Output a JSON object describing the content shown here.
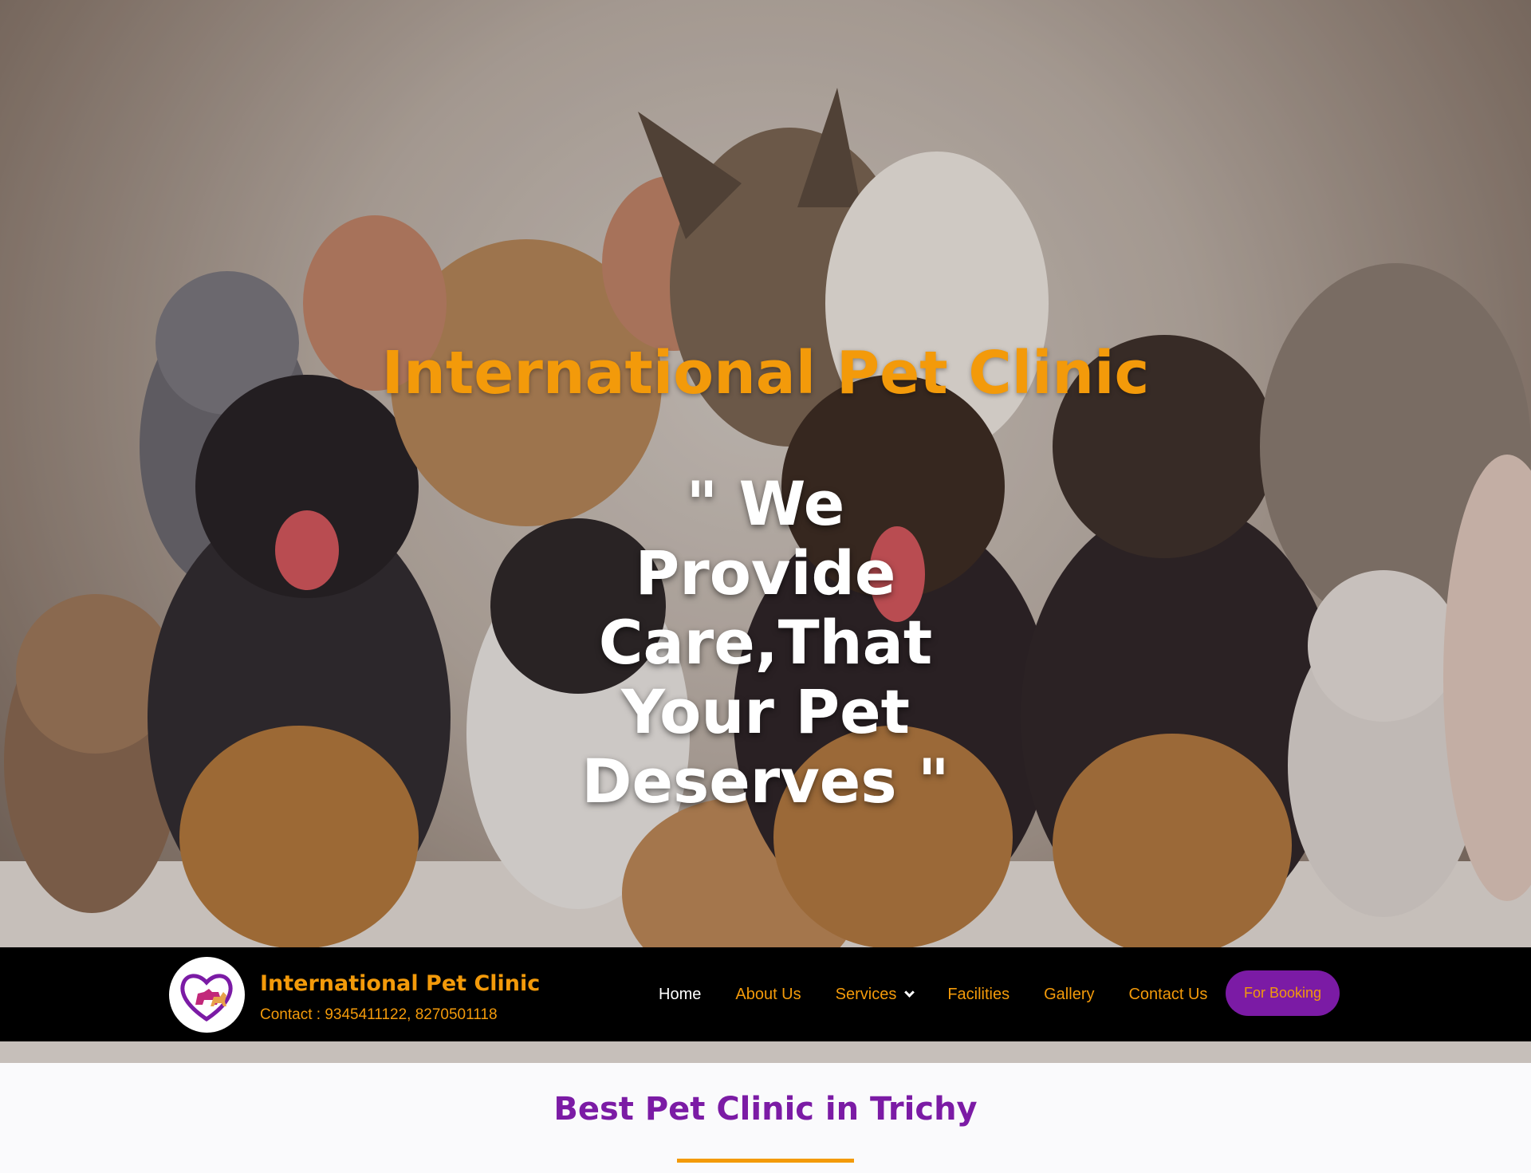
{
  "hero": {
    "title": "International Pet Clinic",
    "quote_lines": [
      "\" We",
      "Provide",
      "Care,That",
      "Your Pet",
      "Deserves \""
    ],
    "image": "puppies-and-kittens-photo"
  },
  "header": {
    "brand_name": "International Pet Clinic",
    "contact": "Contact :  9345411122, 8270501118",
    "logo_icon": "heart-pets-logo"
  },
  "nav": {
    "items": [
      {
        "label": "Home",
        "active": true
      },
      {
        "label": "About Us"
      },
      {
        "label": "Services",
        "has_dropdown": true
      },
      {
        "label": "Facilities"
      },
      {
        "label": "Gallery"
      },
      {
        "label": "Contact Us"
      }
    ],
    "booking_label": "For Booking"
  },
  "section": {
    "title": "Best Pet Clinic in Trichy"
  },
  "colors": {
    "accent_orange": "#f39a0a",
    "brand_purple": "#7b1ba5",
    "navbar_bg": "#000000",
    "page_bg": "#fafafc"
  }
}
